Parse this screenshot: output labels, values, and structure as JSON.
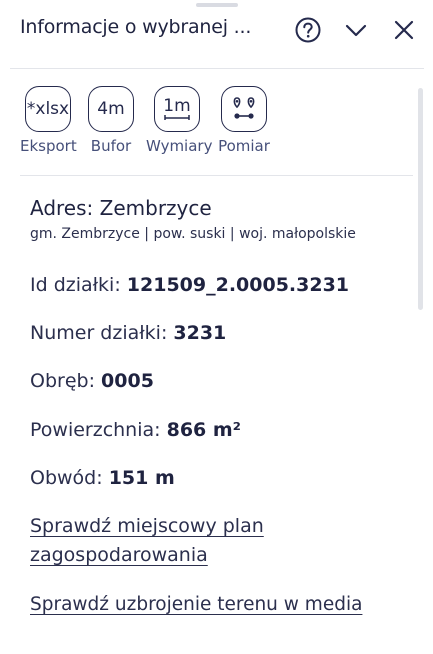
{
  "header": {
    "title": "Informacje o wybranej ...",
    "help_icon": "help-circle-icon",
    "collapse_icon": "chevron-down-icon",
    "close_icon": "close-icon"
  },
  "tools": [
    {
      "icon_text": "*xlsx",
      "label": "Eksport"
    },
    {
      "icon_text": "4m",
      "label": "Bufor"
    },
    {
      "icon_text": "1m",
      "label": "Wymiary"
    },
    {
      "icon": "route-pins-icon",
      "label": "Pomiar"
    }
  ],
  "address": {
    "title": "Adres: Zembrzyce",
    "subtitle": "gm. Zembrzyce | pow. suski | woj. małopolskie"
  },
  "details": [
    {
      "label": "Id działki: ",
      "value": "121509_2.0005.3231"
    },
    {
      "label": "Numer działki: ",
      "value": "3231"
    },
    {
      "label": "Obręb: ",
      "value": "0005"
    },
    {
      "label": "Powierzchnia: ",
      "value": "866 m²"
    },
    {
      "label": "Obwód: ",
      "value": "151 m"
    }
  ],
  "links": {
    "plan_line1": "Sprawdź miejscowy plan",
    "plan_line2": "zagospodarowania",
    "media": "Sprawdź uzbrojenie terenu w media"
  },
  "colors": {
    "text": "#1f2340",
    "muted": "#46507a",
    "divider": "#e3e5ea"
  }
}
